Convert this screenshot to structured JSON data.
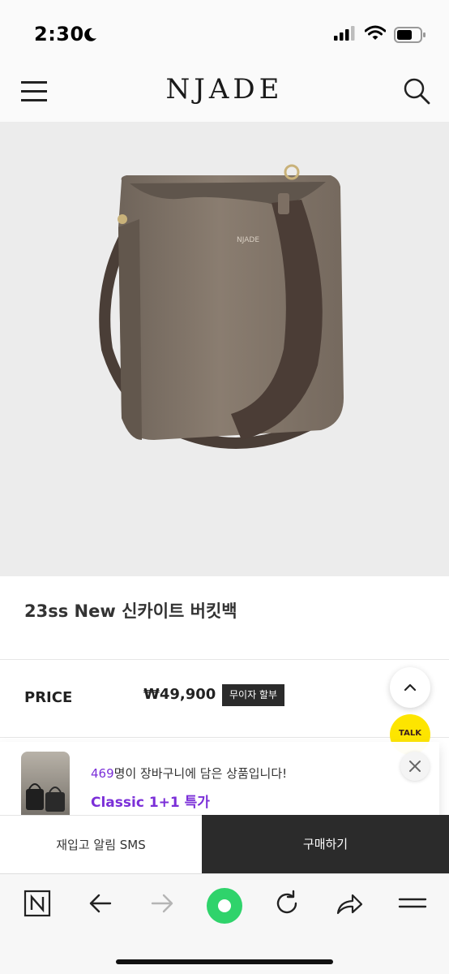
{
  "status_bar": {
    "time": "2:30"
  },
  "header": {
    "logo": "NJADE"
  },
  "product": {
    "title": "23ss New 신카이트 버킷백",
    "price_label": "PRICE",
    "price": "₩49,900",
    "installment_badge": "무이자 할부"
  },
  "kakao": {
    "label": "TALK"
  },
  "toast": {
    "count": "469",
    "message": "명이 장바구니에 담은 상품입니다!",
    "promo": "Classic 1+1 특가"
  },
  "actions": {
    "restock_label": "재입고 알림 SMS",
    "buy_label": "구매하기"
  },
  "colors": {
    "accent_purple": "#7b2fd8",
    "kakao_yellow": "#fde500",
    "dark_button": "#2b2b2b",
    "browser_green": "#2fd36b"
  },
  "icons": {
    "menu": "hamburger-icon",
    "search": "search-icon",
    "scroll_top": "chevron-up-icon",
    "close": "close-icon",
    "browser": [
      "naver-icon",
      "back-arrow-icon",
      "forward-arrow-icon",
      "green-dot-icon",
      "refresh-icon",
      "share-icon",
      "menu-lines-icon"
    ]
  }
}
